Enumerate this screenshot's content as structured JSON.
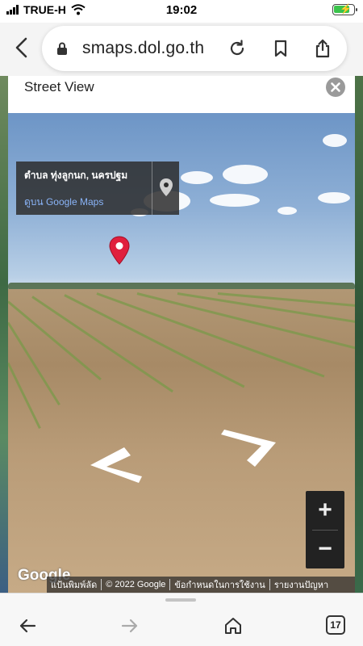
{
  "status_bar": {
    "carrier": "TRUE-H",
    "time": "19:02",
    "battery_level_percent": 82
  },
  "browser": {
    "url": "smaps.dol.go.th",
    "icons": [
      "back-chevron-icon",
      "lock-icon",
      "reload-icon",
      "bookmark-icon",
      "share-icon"
    ]
  },
  "street_view": {
    "title": "Street View",
    "location": "ตำบล ทุ่งลูกนก, นครปฐม",
    "view_link": "ดูบน Google Maps",
    "zoom_in": "+",
    "zoom_out": "−"
  },
  "map_footer": {
    "logo": "Google",
    "shortcuts": "แป้นพิมพ์ลัด",
    "copyright": "© 2022 Google",
    "terms": "ข้อกำหนดในการใช้งาน",
    "report": "รายงานปัญหา"
  },
  "toolbar": {
    "tab_count": "17",
    "icons": [
      "back-arrow-icon",
      "forward-arrow-icon",
      "home-icon",
      "tabs-icon"
    ]
  },
  "colors": {
    "pin_red": "#e01f3d",
    "link_blue": "#8ab4f8"
  }
}
